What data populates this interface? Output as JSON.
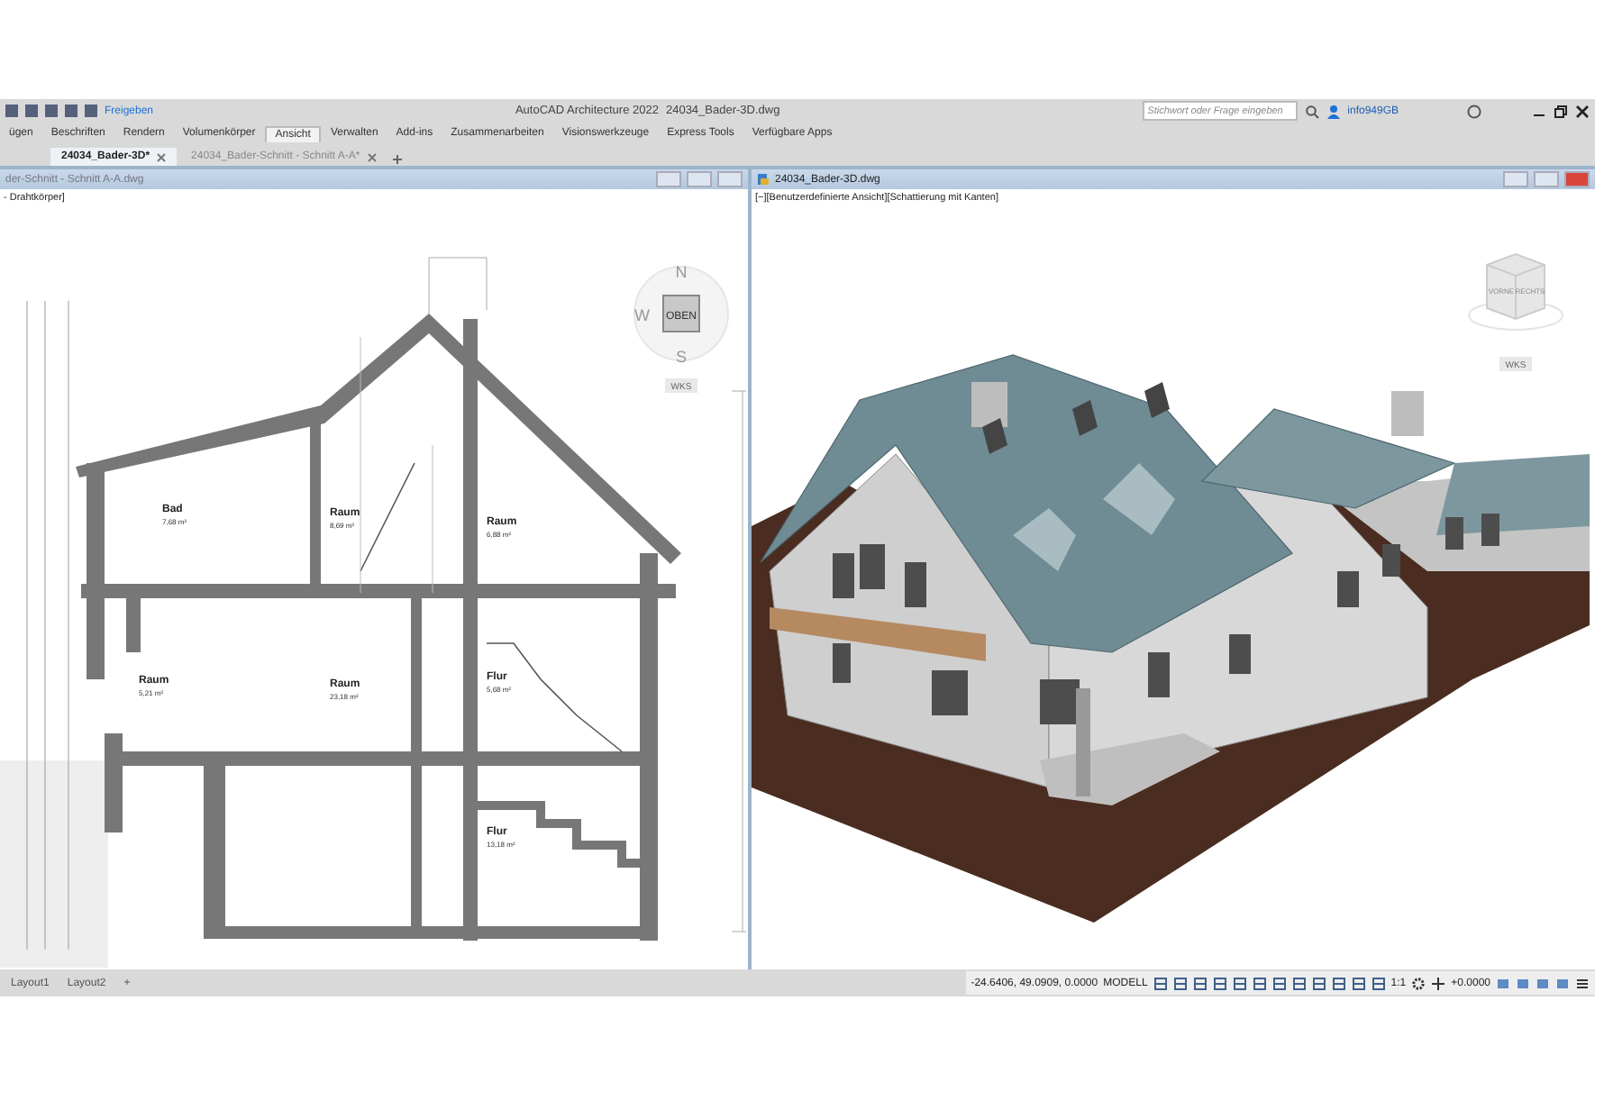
{
  "title_bar": {
    "share": "Freigeben",
    "app_name": "AutoCAD Architecture 2022",
    "file_name": "24034_Bader-3D.dwg",
    "search": {
      "placeholder": "Stichwort oder Frage eingeben"
    },
    "user": "info949GB"
  },
  "ribbon_tabs": [
    {
      "label": "ügen",
      "selected": false
    },
    {
      "label": "Beschriften",
      "selected": false
    },
    {
      "label": "Rendern",
      "selected": false
    },
    {
      "label": "Volumenkörper",
      "selected": false
    },
    {
      "label": "Ansicht",
      "selected": true
    },
    {
      "label": "Verwalten",
      "selected": false
    },
    {
      "label": "Add-ins",
      "selected": false
    },
    {
      "label": "Zusammenarbeiten",
      "selected": false
    },
    {
      "label": "Visionswerkzeuge",
      "selected": false
    },
    {
      "label": "Express Tools",
      "selected": false
    },
    {
      "label": "Verfügbare Apps",
      "selected": false
    }
  ],
  "doc_tabs": [
    {
      "label": "24034_Bader-3D*",
      "selected": true
    },
    {
      "label": "24034_Bader-Schnitt - Schnitt A-A*",
      "selected": false
    }
  ],
  "left_viewport": {
    "title": "der-Schnitt - Schnitt A-A.dwg",
    "view_label": "- Drahtkörper]",
    "compass": {
      "north": "N",
      "south": "S",
      "west": "W",
      "center": "OBEN",
      "ucs": "WKS"
    },
    "rooms": [
      {
        "name": "Bad",
        "area": "7,68 m²"
      },
      {
        "name": "Raum",
        "area": "8,69 m²"
      },
      {
        "name": "Raum",
        "area": "6,88 m²"
      },
      {
        "name": "Raum",
        "area": "5,21 m²"
      },
      {
        "name": "Raum",
        "area": "23,18 m²"
      },
      {
        "name": "Flur",
        "area": "5,68 m²"
      },
      {
        "name": "Flur",
        "area": "13,18 m²"
      }
    ]
  },
  "right_viewport": {
    "title": "24034_Bader-3D.dwg",
    "view_label": "[−][Benutzerdefinierte Ansicht][Schattierung mit Kanten]",
    "viewcube": {
      "front": "VORNE",
      "right": "RECHTS"
    },
    "ucs": "WKS"
  },
  "layout_tabs": [
    "Layout1",
    "Layout2",
    "+"
  ],
  "status_bar": {
    "coordinates": "-24.6406, 49.0909, 0.0000",
    "space": "MODELL",
    "scale": "1:1",
    "value": "+0.0000"
  }
}
